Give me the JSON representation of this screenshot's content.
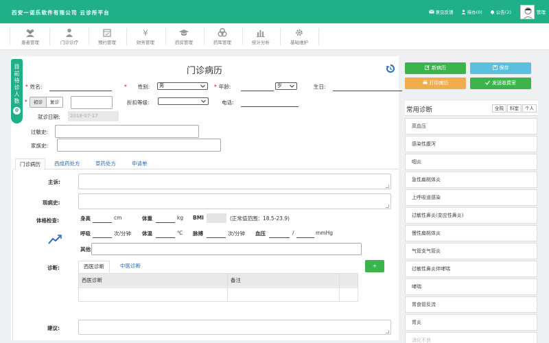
{
  "header": {
    "brand": "西安一诺乐软件有限公司 云诊所平台",
    "links": [
      {
        "label": "意见反馈",
        "icon": "mail-icon"
      },
      {
        "label": "待办(0)",
        "icon": "person-icon"
      },
      {
        "label": "公告(2)",
        "icon": "bell-icon"
      }
    ],
    "user_name": "管理"
  },
  "nav": [
    {
      "label": "患者管理",
      "icon": "users-icon"
    },
    {
      "label": "门诊诊疗",
      "icon": "doctor-icon"
    },
    {
      "label": "预约管理",
      "icon": "calendar-icon"
    },
    {
      "label": "财务管理",
      "icon": "yen-icon"
    },
    {
      "label": "药房管理",
      "icon": "graduation-cap-icon"
    },
    {
      "label": "药库管理",
      "icon": "pills-icon"
    },
    {
      "label": "统计分析",
      "icon": "bar-chart-icon"
    },
    {
      "label": "基础维护",
      "icon": "gear-icon"
    }
  ],
  "side_tab": {
    "label": "目前待诊人数",
    "count": "0"
  },
  "form": {
    "title": "门诊病历",
    "name_label": "姓名:",
    "gender_label": "性别:",
    "gender_value": "男",
    "age_label": "年龄:",
    "age_unit": "岁",
    "birthday_label": "生日:",
    "visit_first": "初诊",
    "visit_return": "复诊",
    "discount_label": "折扣等级:",
    "phone_label": "电话:",
    "date_label": "就诊日期:",
    "date_value": "2018-07-17",
    "allergy_label": "过敏史:",
    "family_label": "家族史:"
  },
  "tabs": [
    "门诊病历",
    "西成药处方",
    "草药处方",
    "申请单"
  ],
  "record": {
    "complaint_label": "主诉:",
    "history_label": "现病史:",
    "exam_label": "体格检查:",
    "height_label": "身高",
    "height_unit": "cm",
    "weight_label": "体重",
    "weight_unit": "kg",
    "bmi_label": "BMI",
    "bmi_range": "(正常值范围：18.5-23.9)",
    "breath_label": "呼吸",
    "breath_unit": "次/分钟",
    "temp_label": "体温",
    "temp_unit": "℃",
    "pulse_label": "脉搏",
    "pulse_unit": "次/分钟",
    "bp_label": "血压",
    "bp_sep": "/",
    "bp_unit": "mmHg",
    "other_label": "其他",
    "diagnosis_label": "诊断:",
    "diag_tabs": [
      "西医诊断",
      "中医诊断"
    ],
    "table_headers": [
      "西医诊断",
      "备注"
    ],
    "add_button": "+",
    "advice_label": "建议:"
  },
  "buttons": {
    "new_record": "新病历",
    "save": "保存",
    "print": "打印病历",
    "send": "发送收费室"
  },
  "common_diagnosis": {
    "title": "常用诊断",
    "scopes": [
      "全院",
      "科室",
      "个人"
    ],
    "items": [
      "高血压",
      "感染性腹泻",
      "咽炎",
      "急性扁桃体炎",
      "上呼吸道感染",
      "过敏性鼻炎(变应性鼻炎)",
      "慢性扁桃体炎",
      "气管支气管炎",
      "过敏性鼻炎伴哮喘",
      "哮喘",
      "胃食管反流",
      "胃炎",
      "消化不良"
    ]
  },
  "colors": {
    "header": "#1fb087",
    "green_btn": "#3db34b",
    "blue_btn": "#5bc0de",
    "orange_btn": "#f0ad4e",
    "link": "#2a6db5"
  }
}
